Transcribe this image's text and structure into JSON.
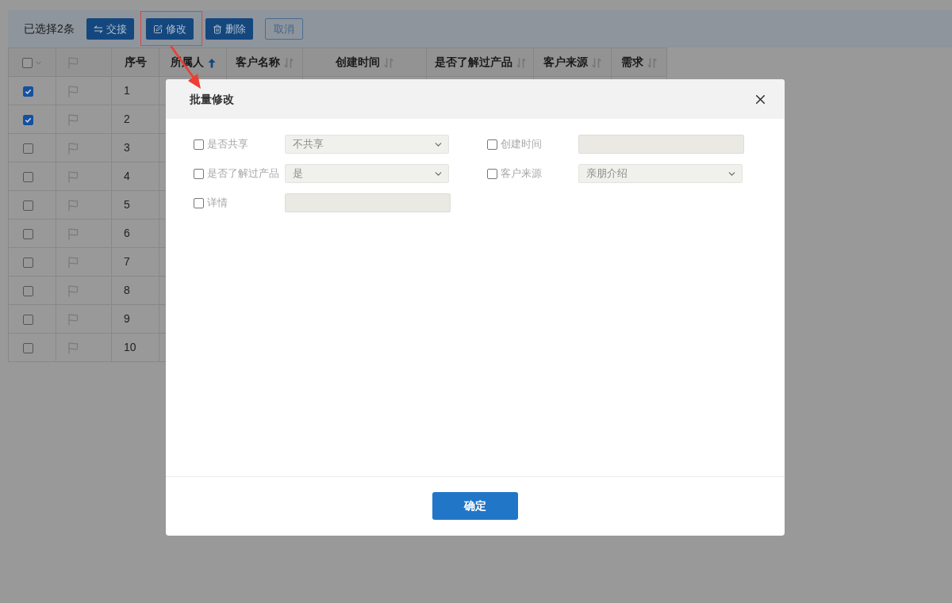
{
  "toolbar": {
    "selection_text": "已选择2条",
    "buttons": [
      {
        "label": "交接",
        "kind": "filled",
        "highlighted": false
      },
      {
        "label": "修改",
        "kind": "filled",
        "highlighted": true
      },
      {
        "label": "删除",
        "kind": "filled",
        "highlighted": false
      },
      {
        "label": "取消",
        "kind": "outline",
        "highlighted": false
      }
    ]
  },
  "table": {
    "select_all": {
      "checked": false
    },
    "columns": [
      {
        "label": "序号",
        "sortable": false
      },
      {
        "label": "所属人",
        "sortable": true,
        "sorted": true
      },
      {
        "label": "客户名称",
        "sortable": true,
        "sorted": false
      },
      {
        "label": "创建时间",
        "sortable": true,
        "sorted": false
      },
      {
        "label": "是否了解过产品",
        "sortable": true,
        "sorted": false
      },
      {
        "label": "客户来源",
        "sortable": true,
        "sorted": false
      },
      {
        "label": "需求",
        "sortable": true,
        "sorted": false
      }
    ],
    "rows": [
      {
        "checked": true,
        "flagged": false,
        "number": "1"
      },
      {
        "checked": true,
        "flagged": false,
        "number": "2"
      },
      {
        "checked": false,
        "flagged": false,
        "number": "3"
      },
      {
        "checked": false,
        "flagged": false,
        "number": "4"
      },
      {
        "checked": false,
        "flagged": false,
        "number": "5"
      },
      {
        "checked": false,
        "flagged": false,
        "number": "6"
      },
      {
        "checked": false,
        "flagged": false,
        "number": "7"
      },
      {
        "checked": false,
        "flagged": false,
        "number": "8"
      },
      {
        "checked": false,
        "flagged": false,
        "number": "9"
      },
      {
        "checked": false,
        "flagged": false,
        "number": "10"
      }
    ]
  },
  "dialog": {
    "title": "批量修改",
    "fields": [
      {
        "label": "是否共享",
        "checked": false,
        "kind": "select",
        "value": "不共享"
      },
      {
        "label": "创建时间",
        "checked": false,
        "kind": "input"
      },
      {
        "label": "是否了解过产品",
        "checked": false,
        "kind": "select",
        "value": "是"
      },
      {
        "label": "客户来源",
        "checked": false,
        "kind": "select",
        "value": "亲朋介绍"
      },
      {
        "label": "详情",
        "checked": false,
        "kind": "input"
      }
    ],
    "confirm": "确定"
  }
}
